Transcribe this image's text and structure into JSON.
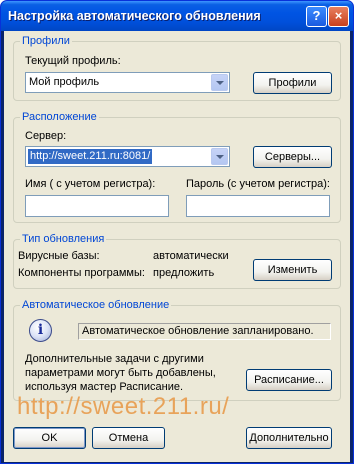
{
  "window": {
    "title": "Настройка автоматического обновления",
    "help_label": "?",
    "close_label": "×"
  },
  "profiles": {
    "group_title": "Профили",
    "current_label": "Текущий профиль:",
    "current_value": "Мой профиль",
    "button_label": "Профили"
  },
  "location": {
    "group_title": "Расположение",
    "server_label": "Сервер:",
    "server_value": "http://sweet.211.ru:8081/",
    "servers_button": "Серверы...",
    "username_label": "Имя ( с учетом регистра):",
    "username_value": "",
    "password_label": "Пароль (с учетом регистра):",
    "password_value": ""
  },
  "update_type": {
    "group_title": "Тип обновления",
    "virus_db_label": "Вирусные базы:",
    "virus_db_value": "автоматически",
    "components_label": "Компоненты программы:",
    "components_value": "предложить",
    "change_button": "Изменить"
  },
  "auto_update": {
    "group_title": "Автоматическое обновление",
    "status_text": "Автоматическое обновление запланировано.",
    "description": "Дополнительные задачи с другими параметрами могут быть добавлены, используя мастер Расписание.",
    "schedule_button": "Расписание..."
  },
  "watermark": "http://sweet.211.ru/",
  "footer": {
    "ok_label": "OK",
    "cancel_label": "Отмена",
    "advanced_label": "Дополнительно"
  },
  "colors": {
    "titlebar": "#0054e3",
    "client_bg": "#ece9d8",
    "group_title": "#0046d5",
    "selection": "#316ac5",
    "watermark": "#e8a35a"
  }
}
